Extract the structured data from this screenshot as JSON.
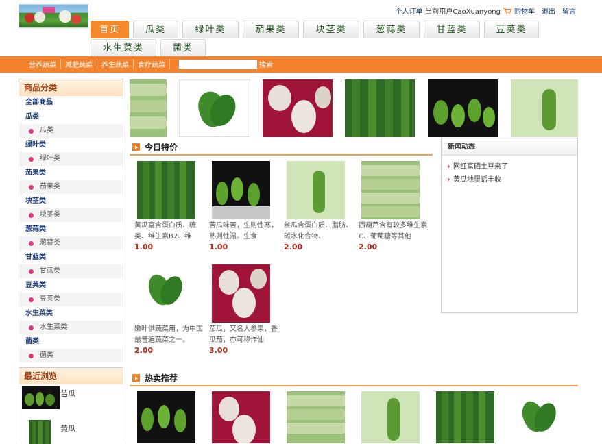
{
  "header": {
    "links": [
      "个人订单",
      "当前用户CaoXuanyong",
      "购物车",
      "退出",
      "留言"
    ]
  },
  "nav": {
    "tabs": [
      "首页",
      "瓜类",
      "绿叶类",
      "茄果类",
      "块茎类",
      "葱蒜类",
      "甘蓝类",
      "豆荚类",
      "水生菜类",
      "菌类"
    ]
  },
  "subnav": {
    "items": [
      "营养蔬菜",
      "减肥蔬菜",
      "养生蔬菜",
      "食疗蔬菜"
    ],
    "search_placeholder": "",
    "search_label": "搜索"
  },
  "sidebar": {
    "title": "商品分类",
    "all": "全部商品",
    "categories": [
      {
        "name": "瓜类",
        "sub": "瓜类"
      },
      {
        "name": "绿叶类",
        "sub": "绿叶类"
      },
      {
        "name": "茄果类",
        "sub": "茄果类"
      },
      {
        "name": "块茎类",
        "sub": "块茎类"
      },
      {
        "name": "葱蒜类",
        "sub": "葱蒜类"
      },
      {
        "name": "甘蓝类",
        "sub": "甘蓝类"
      },
      {
        "name": "豆荚类",
        "sub": "豆荚类"
      },
      {
        "name": "水生菜类",
        "sub": "水生菜类"
      },
      {
        "name": "菌类",
        "sub": "菌类"
      }
    ]
  },
  "recent": {
    "title": "最近浏览",
    "items": [
      "苦瓜",
      "黄瓜"
    ]
  },
  "today": {
    "title": "今日特价",
    "products": [
      {
        "desc": "黄瓜富含蛋白质、糖类、维生素B2、维",
        "price": "1.00"
      },
      {
        "desc": "苦瓜味苦，生则性寒，熟则性温。生食",
        "price": "1.00"
      },
      {
        "desc": "丝瓜含蛋白质、脂肪、碳水化合物、",
        "price": "2.00"
      },
      {
        "desc": "西葫芦含有较多维生素C、葡萄糖等其他",
        "price": "2.00"
      },
      {
        "desc": "嫩叶供蔬菜用，为中国最普遍蔬菜之一。",
        "price": "2.00"
      },
      {
        "desc": "茄瓜，又名人参果，香瓜茄，亦可称作仙",
        "price": "3.00"
      }
    ]
  },
  "news": {
    "title": "新闻动态",
    "items": [
      "网红富硒土豆来了",
      "黄瓜地里话丰收"
    ]
  },
  "hot": {
    "title": "热卖推荐"
  },
  "colors": {
    "accent": "#f5822d",
    "price": "#b02818",
    "link": "#1d3d7a"
  }
}
